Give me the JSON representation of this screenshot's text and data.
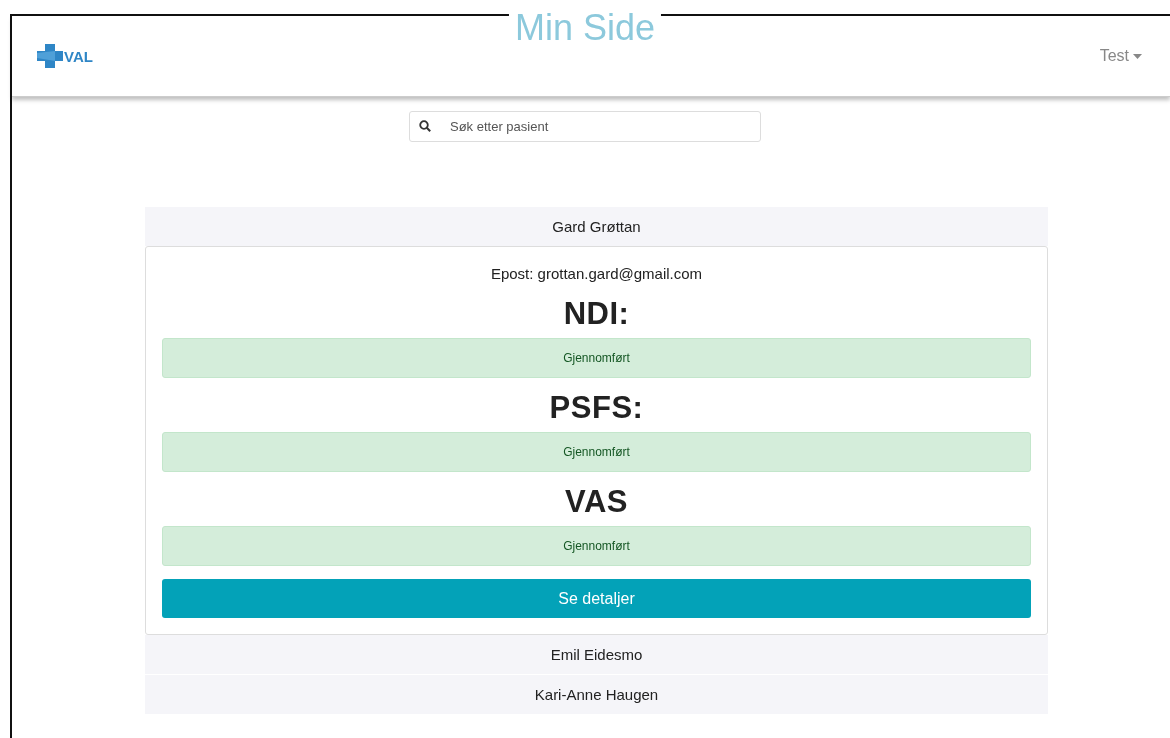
{
  "page_heading": "Min Side",
  "header": {
    "logo_text": "VAL",
    "user_menu": "Test"
  },
  "search": {
    "placeholder": "Søk etter pasient"
  },
  "patients": [
    {
      "name": "Gard Grøttan",
      "expanded": true,
      "email_label": "Epost:",
      "email": "grottan.gard@gmail.com",
      "surveys": [
        {
          "title": "NDI:",
          "status": "Gjennomført"
        },
        {
          "title": "PSFS:",
          "status": "Gjennomført"
        },
        {
          "title": "VAS",
          "status": "Gjennomført"
        }
      ],
      "details_button": "Se detaljer"
    },
    {
      "name": "Emil Eidesmo",
      "expanded": false
    },
    {
      "name": "Kari-Anne Haugen",
      "expanded": false
    }
  ]
}
